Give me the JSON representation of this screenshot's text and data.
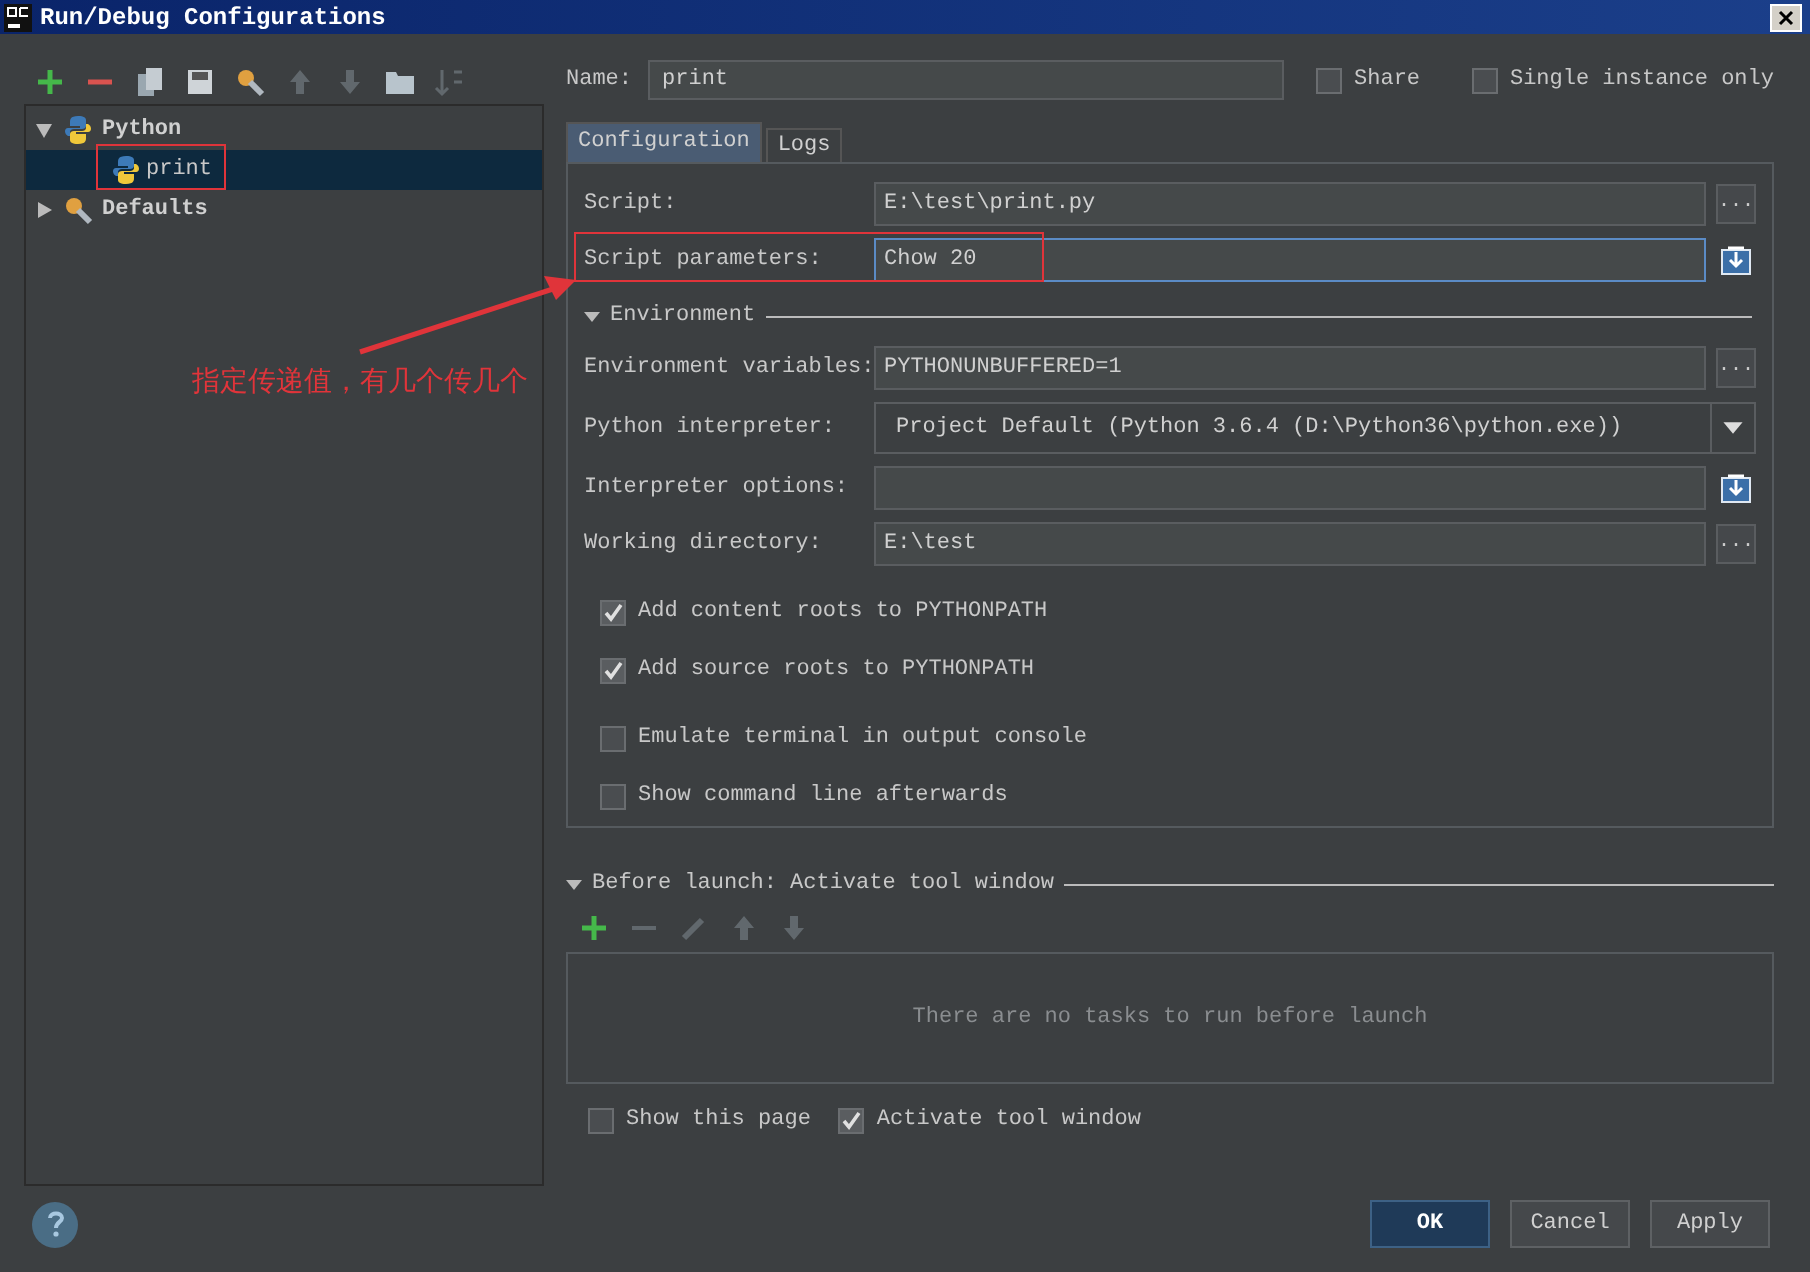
{
  "window": {
    "title": "Run/Debug Configurations"
  },
  "tree": [
    {
      "label": "Python",
      "expanded": true,
      "selected": false,
      "children": [
        {
          "label": "print",
          "selected": true
        }
      ]
    },
    {
      "label": "Defaults",
      "expanded": false,
      "selected": false
    }
  ],
  "name_field": {
    "label": "Name:",
    "value": "print"
  },
  "share": {
    "label": "Share",
    "checked": false
  },
  "single_instance": {
    "label": "Single instance only",
    "checked": false
  },
  "tabs": [
    {
      "label": "Configuration",
      "selected": true
    },
    {
      "label": "Logs",
      "selected": false
    }
  ],
  "fields": [
    {
      "label": "Script:",
      "value": "E:\\test\\print.py",
      "focused": false,
      "action": {
        "kind": "browse",
        "text": "..."
      }
    },
    {
      "label": "Script parameters:",
      "value": "Chow 20",
      "focused": true,
      "action": {
        "kind": "expand"
      }
    }
  ],
  "environment": {
    "title": "Environment",
    "expanded": true,
    "fields": [
      {
        "label": "Environment variables:",
        "value": "PYTHONUNBUFFERED=1",
        "kind": "text",
        "action": {
          "kind": "browse",
          "text": "..."
        }
      },
      {
        "label": "Python interpreter:",
        "value": "Project Default (Python 3.6.4 (D:\\Python36\\python.exe))",
        "kind": "dropdown"
      },
      {
        "label": "Interpreter options:",
        "kind": "text",
        "action": {
          "kind": "expand"
        }
      },
      {
        "label": "Working directory:",
        "value": "E:\\test",
        "kind": "text",
        "action": {
          "kind": "browse",
          "text": "..."
        }
      }
    ]
  },
  "options": [
    {
      "label": "Add content roots to PYTHONPATH",
      "checked": true
    },
    {
      "label": "Add source roots to PYTHONPATH",
      "checked": true
    },
    {
      "label": "Emulate terminal in output console",
      "checked": false
    },
    {
      "label": "Show command line afterwards",
      "checked": false
    }
  ],
  "before_launch": {
    "title": "Before launch: Activate tool window",
    "empty_text": "There are no tasks to run before launch"
  },
  "launch_options": [
    {
      "label": "Show this page",
      "checked": false
    },
    {
      "label": "Activate tool window",
      "checked": true
    }
  ],
  "buttons": [
    {
      "label": "OK",
      "primary": true
    },
    {
      "label": "Cancel",
      "primary": false
    },
    {
      "label": "Apply",
      "primary": false
    }
  ],
  "annotation": {
    "text": "指定传递值，有几个传几个"
  }
}
